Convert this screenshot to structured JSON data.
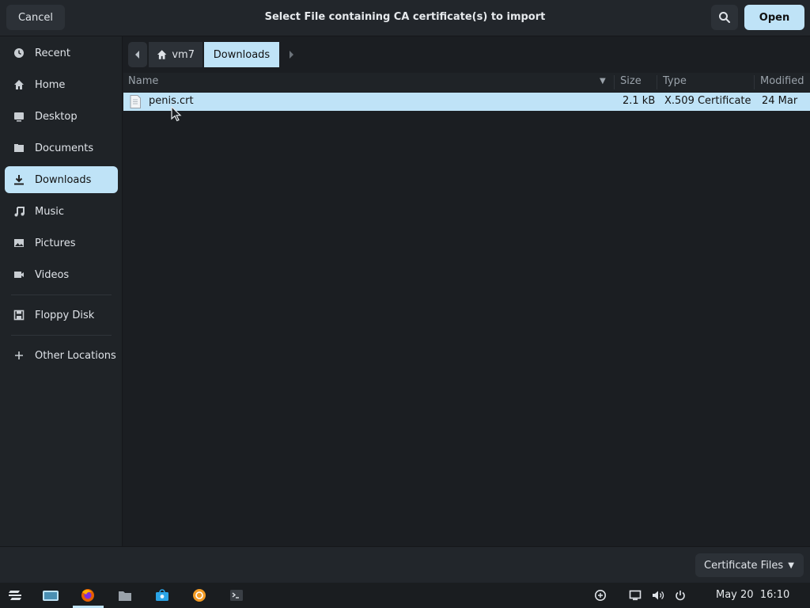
{
  "dialog": {
    "title": "Select File containing CA certificate(s) to import",
    "cancel_label": "Cancel",
    "open_label": "Open"
  },
  "sidebar": {
    "items": [
      {
        "label": "Recent",
        "icon": "clock-icon"
      },
      {
        "label": "Home",
        "icon": "home-icon"
      },
      {
        "label": "Desktop",
        "icon": "desktop-icon"
      },
      {
        "label": "Documents",
        "icon": "documents-icon"
      },
      {
        "label": "Downloads",
        "icon": "download-icon",
        "active": true
      },
      {
        "label": "Music",
        "icon": "music-icon"
      },
      {
        "label": "Pictures",
        "icon": "pictures-icon"
      },
      {
        "label": "Videos",
        "icon": "videos-icon"
      },
      {
        "label": "Floppy Disk",
        "icon": "floppy-icon"
      },
      {
        "label": "Other Locations",
        "icon": "plus-icon"
      }
    ]
  },
  "pathbar": {
    "home_label": "vm7",
    "current_label": "Downloads"
  },
  "filelist": {
    "columns": {
      "name": "Name",
      "size": "Size",
      "type": "Type",
      "modified": "Modified"
    },
    "rows": [
      {
        "name": "penis.crt",
        "size": "2.1 kB",
        "type": "X.509 Certificate",
        "modified": "24 Mar",
        "selected": true
      }
    ]
  },
  "filter": {
    "label": "Certificate Files"
  },
  "taskbar": {
    "clock": "May 20  16:10"
  },
  "colors": {
    "accent": "#bfe3f7",
    "background": "#1b1e22",
    "sidebar": "#1f2327"
  }
}
